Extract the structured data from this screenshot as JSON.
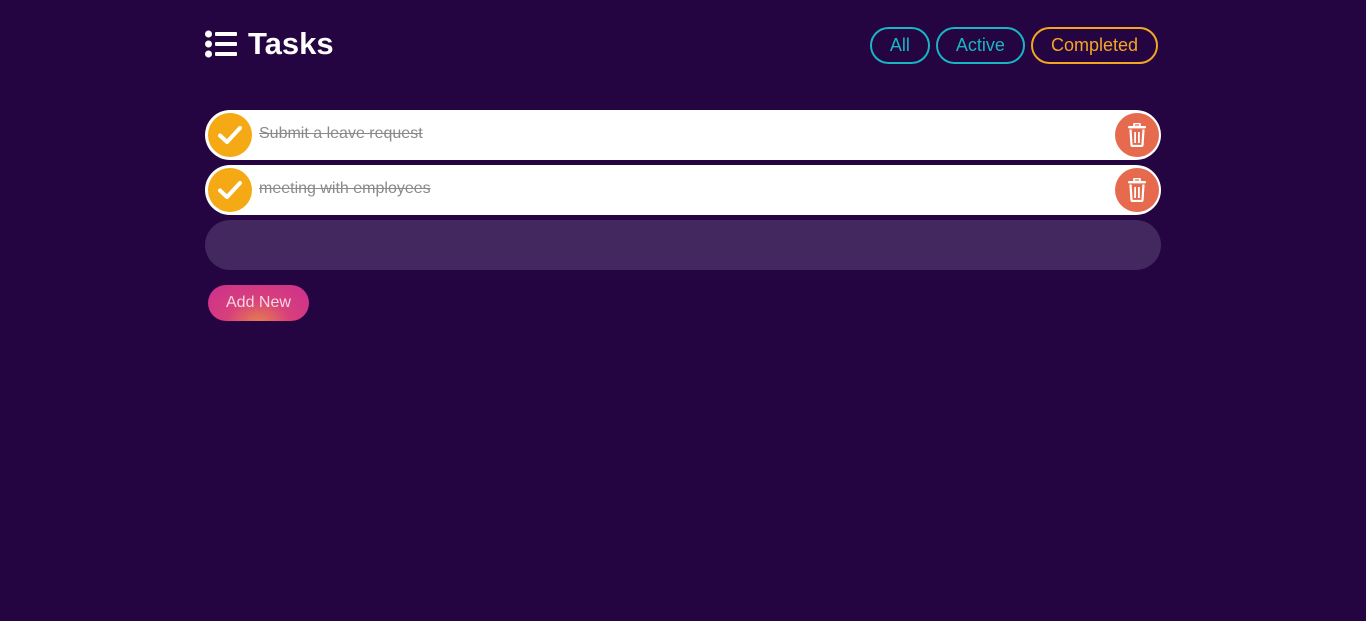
{
  "header": {
    "title": "Tasks",
    "icon": "list-icon"
  },
  "filters": [
    {
      "label": "All",
      "color": "#19b5c3"
    },
    {
      "label": "Active",
      "color": "#19b5c3"
    },
    {
      "label": "Completed",
      "color": "#f4a623"
    }
  ],
  "tasks": [
    {
      "text": "Submit a leave request",
      "completed": true
    },
    {
      "text": "meeting with employees",
      "completed": true
    }
  ],
  "new_task": {
    "value": "",
    "placeholder": ""
  },
  "add_button": {
    "label": "Add New"
  },
  "colors": {
    "background": "#240541",
    "check": "#f4a915",
    "delete": "#e66a4e",
    "input_bg": "#43275f"
  }
}
